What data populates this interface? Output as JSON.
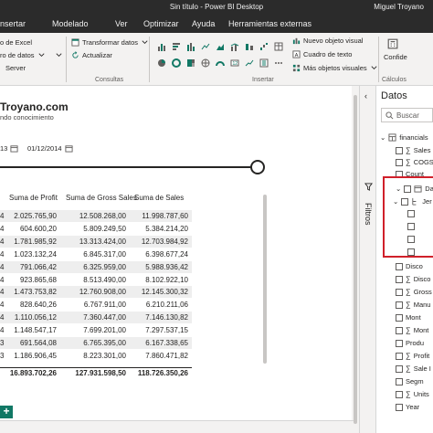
{
  "titlebar": {
    "title": "Sin título - Power BI Desktop",
    "user": "Miguel Troyano"
  },
  "ribbon_tabs": [
    "nsertar",
    "Modelado",
    "Ver",
    "Optimizar",
    "Ayuda",
    "Herramientas externas"
  ],
  "ribbon": {
    "excel": "o de Excel",
    "datos": "ro de datos",
    "server": "Server",
    "transform": "Transformar datos",
    "actualizar": "Actualizar",
    "group_consultas": "Consultas",
    "group_insertar": "Insertar",
    "nuevo_visual": "Nuevo objeto visual",
    "cuadro_texto": "Cuadro de texto",
    "mas_visuales": "Más objetos visuales",
    "confide": "Confide",
    "group_calculos": "Cálculos"
  },
  "canvas": {
    "brand": "Troyano.com",
    "tagline": "ndo conocimiento",
    "date_start": "13",
    "date_end": "01/12/2014"
  },
  "table": {
    "headers": [
      "Suma de Profit",
      "Suma de Gross Sales",
      "Suma de Sales"
    ],
    "rows": [
      {
        "k": "4",
        "profit": "2.025.765,90",
        "gross": "12.508.268,00",
        "sales": "11.998.787,60"
      },
      {
        "k": "4",
        "profit": "604.600,20",
        "gross": "5.809.249,50",
        "sales": "5.384.214,20"
      },
      {
        "k": "4",
        "profit": "1.781.985,92",
        "gross": "13.313.424,00",
        "sales": "12.703.984,92"
      },
      {
        "k": "4",
        "profit": "1.023.132,24",
        "gross": "6.845.317,00",
        "sales": "6.398.677,24"
      },
      {
        "k": "4",
        "profit": "791.066,42",
        "gross": "6.325.959,00",
        "sales": "5.988.936,42"
      },
      {
        "k": "4",
        "profit": "923.865,68",
        "gross": "8.513.490,00",
        "sales": "8.102.922,10"
      },
      {
        "k": "4",
        "profit": "1.473.753,82",
        "gross": "12.760.908,00",
        "sales": "12.145.300,32"
      },
      {
        "k": "4",
        "profit": "828.640,26",
        "gross": "6.767.911,00",
        "sales": "6.210.211,06"
      },
      {
        "k": "4",
        "profit": "1.110.056,12",
        "gross": "7.360.447,00",
        "sales": "7.146.130,82"
      },
      {
        "k": "4",
        "profit": "1.148.547,17",
        "gross": "7.699.201,00",
        "sales": "7.297.537,15"
      },
      {
        "k": "3",
        "profit": "691.564,08",
        "gross": "6.765.395,00",
        "sales": "6.167.338,65"
      },
      {
        "k": "3",
        "profit": "1.186.906,45",
        "gross": "8.223.301,00",
        "sales": "7.860.471,82"
      }
    ],
    "totals": {
      "profit": "16.893.702,26",
      "gross": "127.931.598,50",
      "sales": "118.726.350,26"
    }
  },
  "filters": {
    "label": "Filtros"
  },
  "data_pane": {
    "title": "Datos",
    "search_placeholder": "Buscar",
    "fields": [
      {
        "label": "financials",
        "type": "table"
      },
      {
        "label": "Sales",
        "type": "sigma"
      },
      {
        "label": "COGS",
        "type": "sigma"
      },
      {
        "label": "Count",
        "type": "plain"
      },
      {
        "label": "Date",
        "type": "date"
      },
      {
        "label": "Jer",
        "type": "hier"
      },
      {
        "label": "",
        "type": "sub"
      },
      {
        "label": "",
        "type": "sub"
      },
      {
        "label": "",
        "type": "sub"
      },
      {
        "label": "",
        "type": "sub"
      },
      {
        "label": "Disco",
        "type": "plain"
      },
      {
        "label": "Disco",
        "type": "sigma"
      },
      {
        "label": "Gross",
        "type": "sigma"
      },
      {
        "label": "Manu",
        "type": "sigma"
      },
      {
        "label": "Mont",
        "type": "plain"
      },
      {
        "label": "Mont",
        "type": "sigma"
      },
      {
        "label": "Produ",
        "type": "plain"
      },
      {
        "label": "Profit",
        "type": "sigma"
      },
      {
        "label": "Sale I",
        "type": "sigma"
      },
      {
        "label": "Segm",
        "type": "plain"
      },
      {
        "label": "Units",
        "type": "sigma"
      },
      {
        "label": "Year",
        "type": "plain"
      }
    ]
  },
  "colors": {
    "accent": "#117865",
    "highlight": "#d0202a",
    "titlebar": "#2b2b2b"
  }
}
